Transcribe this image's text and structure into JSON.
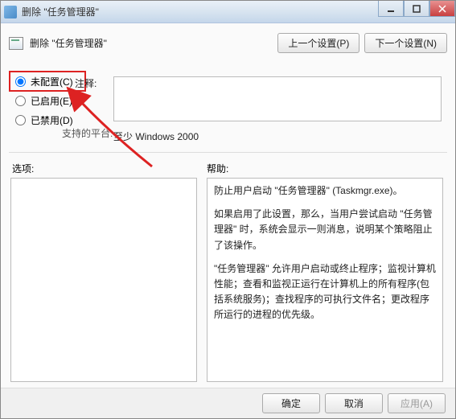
{
  "window": {
    "title": "删除  \"任务管理器\""
  },
  "header": {
    "title": "删除 \"任务管理器\"",
    "prev_label": "上一个设置(P)",
    "next_label": "下一个设置(N)"
  },
  "radios": {
    "not_configured": "未配置(C)",
    "enabled": "已启用(E)",
    "disabled": "已禁用(D)",
    "selected": "not_configured"
  },
  "comment": {
    "label": "注释:",
    "value": ""
  },
  "platform": {
    "label": "支持的平台:",
    "value": "至少 Windows 2000"
  },
  "sections": {
    "options_label": "选项:",
    "help_label": "帮助:"
  },
  "help": {
    "p1": "防止用户启动 \"任务管理器\" (Taskmgr.exe)。",
    "p2": "如果启用了此设置，那么，当用户尝试启动 \"任务管理器\" 时，系统会显示一则消息，说明某个策略阻止了该操作。",
    "p3": "\"任务管理器\" 允许用户启动或终止程序；监视计算机性能；查看和监视正运行在计算机上的所有程序(包括系统服务)；查找程序的可执行文件名；更改程序所运行的进程的优先级。"
  },
  "footer": {
    "ok": "确定",
    "cancel": "取消",
    "apply": "应用(A)"
  }
}
